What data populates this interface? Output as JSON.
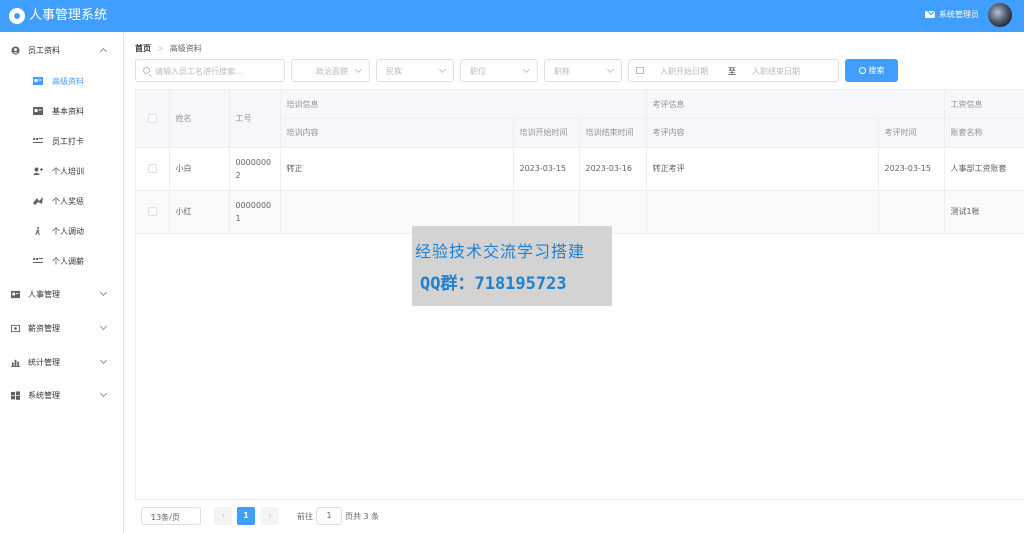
{
  "header": {
    "title": "人事管理系统",
    "user": "系统管理员"
  },
  "sidebar": {
    "group_employee": "员工资料",
    "sub_items": [
      "高级资料",
      "基本资料",
      "员工打卡",
      "个人培训",
      "个人奖惩",
      "个人调动",
      "个人调薪"
    ],
    "groups": [
      "人事管理",
      "薪资管理",
      "统计管理",
      "系统管理"
    ]
  },
  "breadcrumb": {
    "home": "首页",
    "current": "高级资料"
  },
  "filters": {
    "search_placeholder": "请输入员工名进行搜索...",
    "political": "政治面貌",
    "nation": "民族",
    "position": "职位",
    "title": "职称",
    "date_start": "入职开始日期",
    "date_sep": "至",
    "date_end": "入职结束日期",
    "search_button": "搜索"
  },
  "table": {
    "group_headers": {
      "training": "培训信息",
      "evaluation": "考评信息",
      "salary": "工资信息"
    },
    "headers": {
      "name": "姓名",
      "work_id": "工号",
      "train_content": "培训内容",
      "train_start": "培训开始时间",
      "train_end": "培训结束时间",
      "eval_content": "考评内容",
      "eval_date": "考评时间",
      "account_name": "账套名称"
    },
    "rows": [
      {
        "name": "小白",
        "work_id": "00000002",
        "train_content": "转正",
        "train_start": "2023-03-15",
        "train_end": "2023-03-16",
        "eval_content": "转正考评",
        "eval_date": "2023-03-15",
        "account_name": "人事部工资账套"
      },
      {
        "name": "小红",
        "work_id": "00000001",
        "train_content": "",
        "train_start": "",
        "train_end": "",
        "eval_content": "",
        "eval_date": "",
        "account_name": "测试1帐"
      }
    ]
  },
  "pagination": {
    "page_size": "13条/页",
    "prev": "‹",
    "next": "›",
    "current_page": "1",
    "goto_label": "前往",
    "goto_value": "1",
    "total_label": "页共 3 条"
  },
  "watermark": {
    "line1": "经验技术交流学习搭建",
    "line2": "QQ群：718195723"
  },
  "colors": {
    "primary": "#409eff",
    "header_bg": "#409eff"
  }
}
